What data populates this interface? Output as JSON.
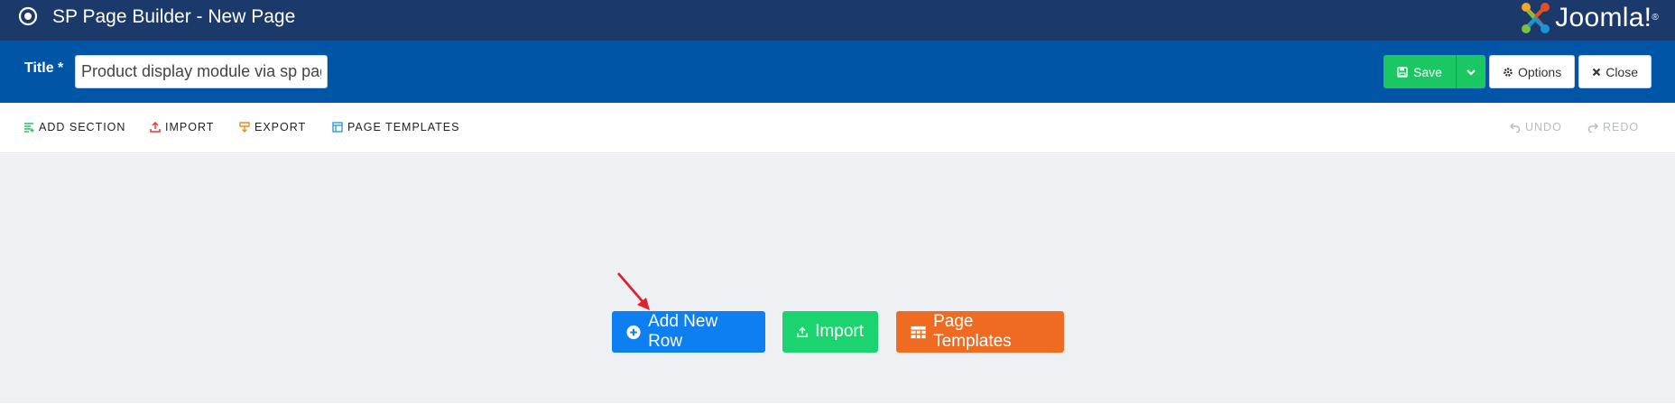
{
  "header": {
    "app_title": "SP Page Builder - New Page",
    "brand_name": "Joomla!",
    "brand_reg": "®",
    "brand_colors": [
      "#e44d26",
      "#f5a623",
      "#1c94d2",
      "#7ac143"
    ]
  },
  "titlebar": {
    "label": "Title *",
    "input_value": "Product display module via sp page builder"
  },
  "actions": {
    "save": "Save",
    "options": "Options",
    "close": "Close"
  },
  "toolbar": {
    "add_section": "ADD SECTION",
    "import": "IMPORT",
    "export": "EXPORT",
    "page_templates": "PAGE TEMPLATES",
    "undo": "UNDO",
    "redo": "REDO"
  },
  "canvas": {
    "add_new_row": "Add New Row",
    "import": "Import",
    "page_templates": "Page Templates"
  },
  "colors": {
    "header_bg": "#1b3a6b",
    "titlebar_bg": "#0155a7",
    "save_green": "#1bc763",
    "add_row_blue": "#0d7ff0",
    "import_green": "#1bd36f",
    "templates_orange": "#f06b22",
    "annotation_arrow": "#e0202a"
  }
}
